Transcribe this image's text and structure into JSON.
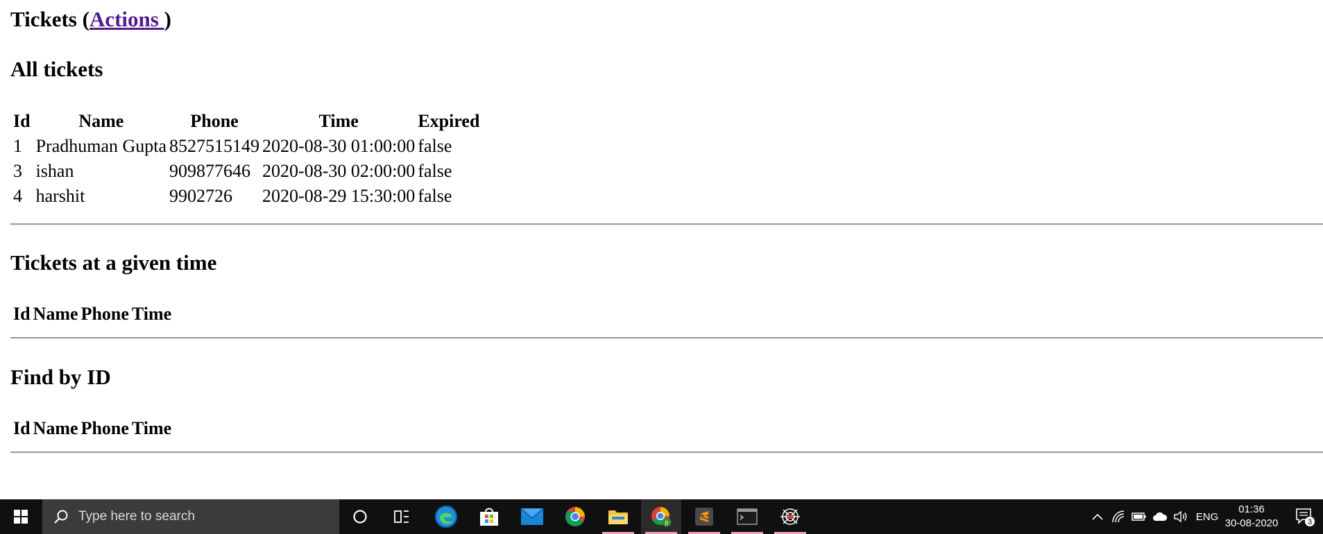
{
  "page": {
    "title_prefix": "Tickets (",
    "title_link": "Actions ",
    "title_suffix": ")",
    "sections": {
      "all": "All tickets",
      "given_time": "Tickets at a given time",
      "find_by_id": "Find by ID"
    },
    "all_table": {
      "headers": [
        "Id",
        "Name",
        "Phone",
        "Time",
        "Expired"
      ],
      "rows": [
        [
          "1",
          "Pradhuman Gupta",
          "8527515149",
          "2020-08-30 01:00:00",
          "false"
        ],
        [
          "3",
          "ishan",
          "909877646",
          "2020-08-30 02:00:00",
          "false"
        ],
        [
          "4",
          "harshit",
          "9902726",
          "2020-08-29 15:30:00",
          "false"
        ]
      ]
    },
    "given_time_table": {
      "headers": [
        "Id",
        "Name",
        "Phone",
        "Time"
      ]
    },
    "find_table": {
      "headers": [
        "Id",
        "Name",
        "Phone",
        "Time"
      ]
    }
  },
  "taskbar": {
    "search_placeholder": "Type here to search",
    "apps": [
      "cortana-icon",
      "task-view-icon",
      "edge-icon",
      "store-icon",
      "mail-icon",
      "chrome-icon",
      "file-explorer-icon",
      "chrome-profile-icon",
      "sublime-text-icon",
      "terminal-icon",
      "spider-app-icon"
    ],
    "tray": {
      "language": "ENG",
      "time": "01:36",
      "date": "30-08-2020",
      "notification_count": "3"
    },
    "colors": {
      "background": "#101010",
      "search_bg": "#3b3b3b",
      "active_underline": "#f39fb8"
    }
  },
  "colors": {
    "link": "#551a8b"
  }
}
